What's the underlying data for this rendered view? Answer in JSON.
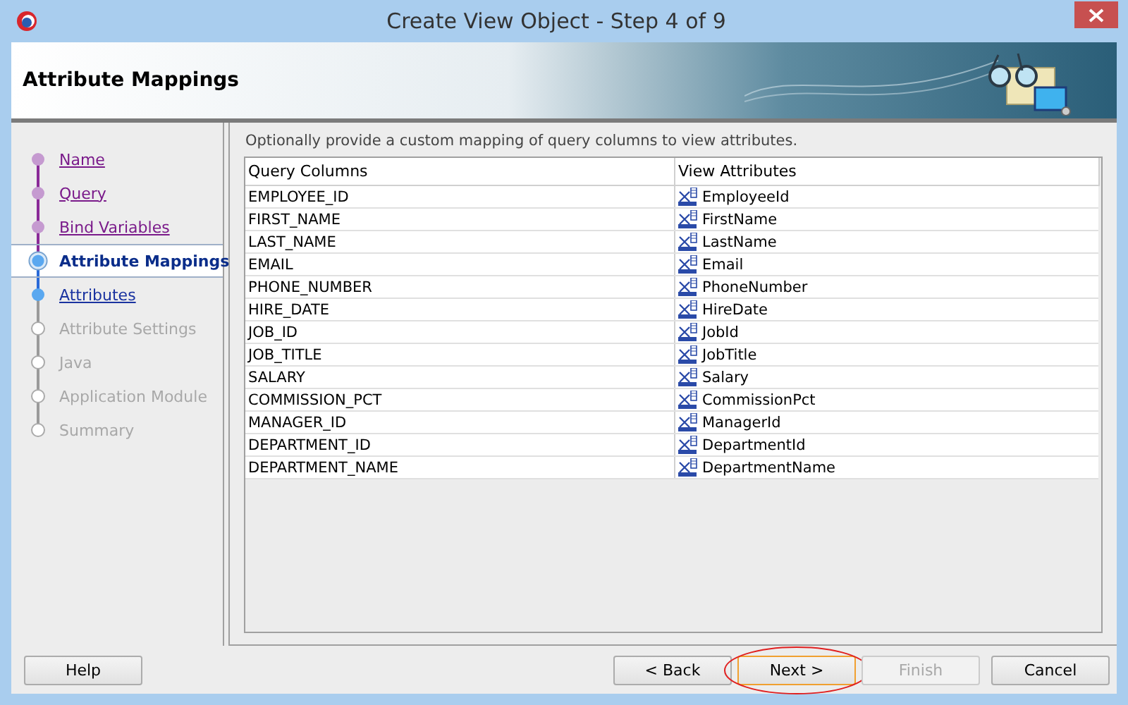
{
  "window": {
    "title": "Create View Object - Step 4 of 9"
  },
  "header": {
    "title": "Attribute Mappings"
  },
  "steps": [
    {
      "label": "Name",
      "visited": true,
      "disabled": false,
      "selected": false
    },
    {
      "label": "Query",
      "visited": true,
      "disabled": false,
      "selected": false
    },
    {
      "label": "Bind Variables",
      "visited": true,
      "disabled": false,
      "selected": false
    },
    {
      "label": "Attribute Mappings",
      "visited": false,
      "disabled": false,
      "selected": true
    },
    {
      "label": "Attributes",
      "visited": false,
      "disabled": false,
      "selected": false
    },
    {
      "label": "Attribute Settings",
      "visited": false,
      "disabled": true,
      "selected": false
    },
    {
      "label": "Java",
      "visited": false,
      "disabled": true,
      "selected": false
    },
    {
      "label": "Application Module",
      "visited": false,
      "disabled": true,
      "selected": false
    },
    {
      "label": "Summary",
      "visited": false,
      "disabled": true,
      "selected": false
    }
  ],
  "instructions": "Optionally provide a custom mapping of query columns to view attributes.",
  "table": {
    "columns": [
      "Query Columns",
      "View Attributes"
    ],
    "rows": [
      [
        "EMPLOYEE_ID",
        "EmployeeId"
      ],
      [
        "FIRST_NAME",
        "FirstName"
      ],
      [
        "LAST_NAME",
        "LastName"
      ],
      [
        "EMAIL",
        "Email"
      ],
      [
        "PHONE_NUMBER",
        "PhoneNumber"
      ],
      [
        "HIRE_DATE",
        "HireDate"
      ],
      [
        "JOB_ID",
        "JobId"
      ],
      [
        "JOB_TITLE",
        "JobTitle"
      ],
      [
        "SALARY",
        "Salary"
      ],
      [
        "COMMISSION_PCT",
        "CommissionPct"
      ],
      [
        "MANAGER_ID",
        "ManagerId"
      ],
      [
        "DEPARTMENT_ID",
        "DepartmentId"
      ],
      [
        "DEPARTMENT_NAME",
        "DepartmentName"
      ]
    ]
  },
  "buttons": [
    {
      "label": "Help",
      "kind": "help",
      "disabled": false,
      "focused": false,
      "circled": false
    },
    {
      "label": "< Back",
      "kind": "nav",
      "disabled": false,
      "focused": false,
      "circled": false
    },
    {
      "label": "Next >",
      "kind": "nav",
      "disabled": false,
      "focused": true,
      "circled": true
    },
    {
      "label": "Finish",
      "kind": "nav",
      "disabled": true,
      "focused": false,
      "circled": false
    },
    {
      "label": "Cancel",
      "kind": "cancel",
      "disabled": false,
      "focused": false,
      "circled": false
    }
  ]
}
